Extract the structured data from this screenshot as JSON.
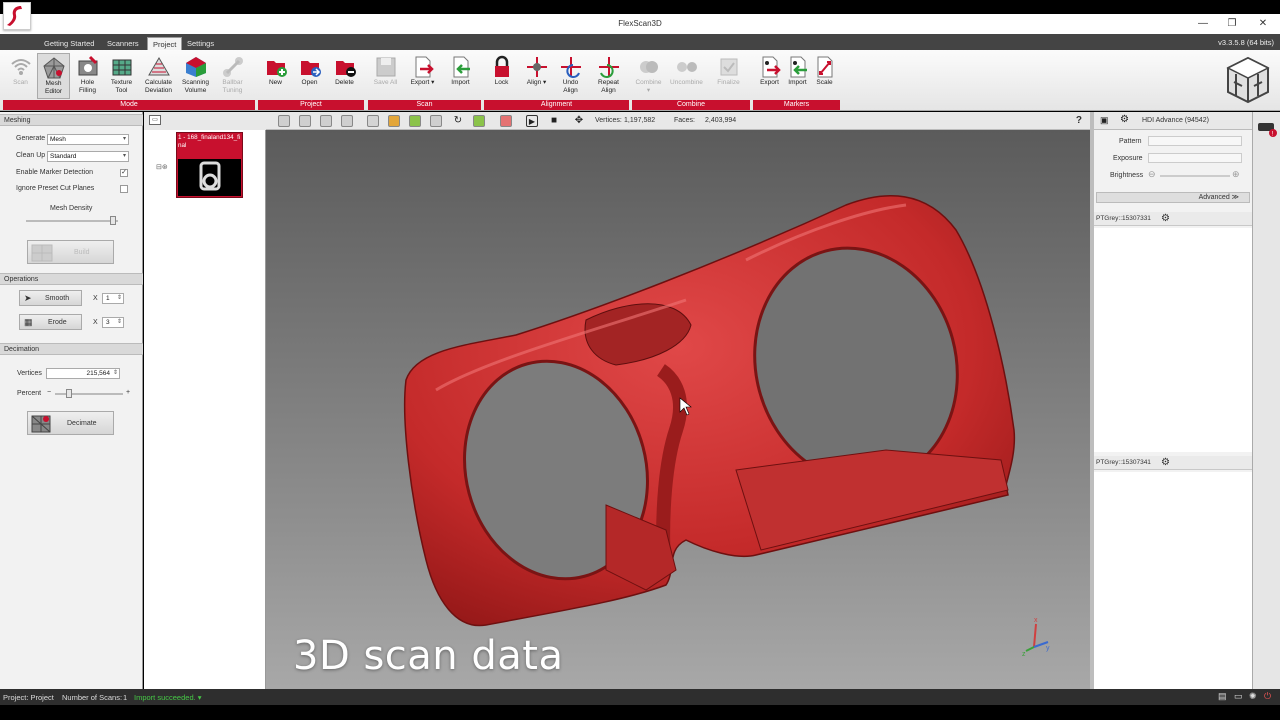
{
  "window": {
    "title": "FlexScan3D",
    "minimize": "—",
    "restore": "❐",
    "close": "✕"
  },
  "menu": {
    "tabs": [
      "Getting Started",
      "Scanners",
      "Project",
      "Settings"
    ],
    "active": "Project",
    "version": "v3.3.5.8 (64 bits)"
  },
  "ribbon": {
    "groups": [
      {
        "label": "Mode",
        "buttons": [
          {
            "label": "Scan",
            "icon": "wifi-icon",
            "disabled": true
          },
          {
            "label": "Mesh\nEditor",
            "icon": "mesh-editor-icon",
            "pressed": true
          },
          {
            "label": "Hole\nFilling",
            "icon": "hole-filling-icon"
          },
          {
            "label": "Texture\nTool",
            "icon": "texture-tool-icon"
          },
          {
            "label": "Calculate\nDeviation",
            "icon": "calculate-deviation-icon"
          },
          {
            "label": "Scanning\nVolume",
            "icon": "scanning-volume-icon"
          },
          {
            "label": "Ballbar\nTuning",
            "icon": "ballbar-tuning-icon",
            "disabled": true
          }
        ]
      },
      {
        "label": "Project",
        "buttons": [
          {
            "label": "New",
            "icon": "new-project-icon"
          },
          {
            "label": "Open",
            "icon": "open-project-icon"
          },
          {
            "label": "Delete",
            "icon": "delete-project-icon"
          }
        ]
      },
      {
        "label": "Scan",
        "buttons": [
          {
            "label": "Save All",
            "icon": "save-all-icon",
            "disabled": true
          },
          {
            "label": "Export ▾",
            "icon": "export-scan-icon"
          },
          {
            "label": "Import",
            "icon": "import-scan-icon"
          }
        ]
      },
      {
        "label": "Alignment",
        "buttons": [
          {
            "label": "Lock",
            "icon": "lock-icon"
          },
          {
            "label": "Align ▾",
            "icon": "align-icon"
          },
          {
            "label": "Undo\nAlign",
            "icon": "undo-align-icon"
          },
          {
            "label": "Repeat\nAlign",
            "icon": "repeat-align-icon"
          }
        ]
      },
      {
        "label": "Combine",
        "buttons": [
          {
            "label": "Combine\n▾",
            "icon": "combine-icon",
            "disabled": true
          },
          {
            "label": "Uncombine",
            "icon": "uncombine-icon",
            "disabled": true
          },
          {
            "label": "Finalize",
            "icon": "finalize-icon",
            "disabled": true
          }
        ]
      },
      {
        "label": "Markers",
        "buttons": [
          {
            "label": "Export",
            "icon": "export-markers-icon"
          },
          {
            "label": "Import",
            "icon": "import-markers-icon"
          },
          {
            "label": "Scale",
            "icon": "scale-icon"
          }
        ]
      }
    ]
  },
  "meshing": {
    "title": "Meshing",
    "generate_label": "Generate",
    "generate_value": "Mesh",
    "cleanup_label": "Clean Up",
    "cleanup_value": "Standard",
    "marker_detection_label": "Enable Marker Detection",
    "marker_detection_checked": true,
    "ignore_planes_label": "Ignore Preset Cut Planes",
    "ignore_planes_checked": false,
    "mesh_density_label": "Mesh Density",
    "mesh_density_level": 0.95,
    "build_label": "Build"
  },
  "operations": {
    "title": "Operations",
    "smooth_label": "Smooth",
    "smooth_times_label": "X",
    "smooth_times": "1",
    "erode_label": "Erode",
    "erode_times_label": "X",
    "erode_times": "3"
  },
  "decimation": {
    "title": "Decimation",
    "vertices_label": "Vertices",
    "vertices_value": "215,564",
    "percent_label": "Percent",
    "percent_minus": "−",
    "percent_plus": "+",
    "percent_level": 0.2,
    "decimate_label": "Decimate"
  },
  "scan_list": {
    "items": [
      {
        "name": "1 - 168_finaland134_final"
      }
    ]
  },
  "viewport": {
    "vertices_label": "Vertices:",
    "vertices_value": "1,197,582",
    "faces_label": "Faces:",
    "faces_value": "2,403,994",
    "help": "?",
    "caption": "3D scan data",
    "axis_labels": {
      "x": "x",
      "y": "y",
      "z": "z"
    }
  },
  "camera_panel": {
    "device": "HDI Advance (94542)",
    "pattern_label": "Pattern",
    "exposure_label": "Exposure",
    "brightness_label": "Brightness",
    "advanced_label": "Advanced ≫",
    "camera1": "PTGrey::15307331",
    "camera2": "PTGrey::15307341"
  },
  "statusbar": {
    "project": "Project: Project",
    "num_scans": "Number of Scans:",
    "num_scans_value": "1",
    "status": "Import succeeded. ▾"
  },
  "colors": {
    "accent_red": "#c8102e",
    "model_red": "#c42a2a",
    "status_green": "#46c846"
  }
}
